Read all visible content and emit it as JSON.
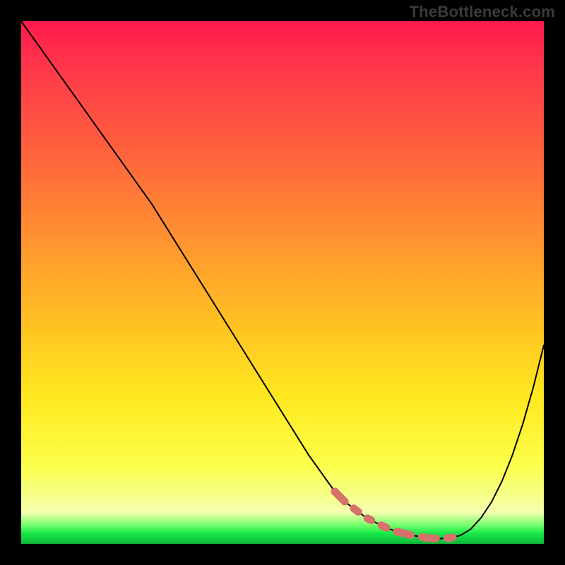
{
  "watermark": "TheBottleneck.com",
  "colors": {
    "background": "#000000",
    "gradient_stops": [
      "#ff1a4d",
      "#ff3a4a",
      "#ff6a3a",
      "#ff9430",
      "#ffc222",
      "#ffe820",
      "#fbff4a",
      "#f4ffad",
      "#6fff6a",
      "#18e848",
      "#0fb838"
    ],
    "curve": "#000000",
    "dash": "#d6726b"
  },
  "chart_data": {
    "type": "line",
    "title": "",
    "xlabel": "",
    "ylabel": "",
    "xlim": [
      0,
      100
    ],
    "ylim": [
      0,
      100
    ],
    "series": [
      {
        "name": "curve",
        "x": [
          0,
          5,
          10,
          15,
          20,
          25,
          30,
          35,
          40,
          45,
          50,
          55,
          60,
          62,
          64,
          66,
          68,
          70,
          72,
          74,
          76,
          78,
          80,
          82,
          84,
          86,
          88,
          90,
          92,
          94,
          96,
          98,
          100
        ],
        "values": [
          100,
          93,
          86,
          79,
          72,
          65,
          57,
          49,
          41,
          33,
          25,
          17,
          10,
          8,
          6.5,
          5,
          4,
          3,
          2.3,
          1.8,
          1.4,
          1.1,
          1,
          1.1,
          1.6,
          2.8,
          5,
          8,
          12,
          17,
          23,
          30,
          38
        ]
      }
    ],
    "annotations": [
      {
        "name": "trough-dashes",
        "x_range": [
          60,
          84
        ],
        "y_approx": 1.3
      }
    ]
  }
}
